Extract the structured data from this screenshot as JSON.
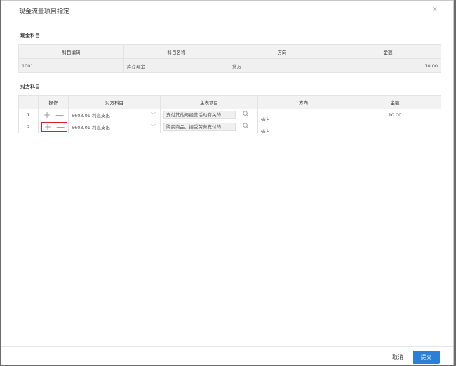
{
  "dialog": {
    "title": "现金流量项目指定",
    "close_glyph": "×"
  },
  "cash_section": {
    "title": "现金科目",
    "headers": [
      "科目编码",
      "科目名称",
      "方向",
      "金额"
    ],
    "row": {
      "code": "1001",
      "name": "库存现金",
      "direction": "贷方",
      "amount": "10.00"
    }
  },
  "counter_section": {
    "title": "对方科目",
    "headers": [
      "",
      "操作",
      "对方科目",
      "主表项目",
      "方向",
      "金额"
    ],
    "rows": [
      {
        "index": "1",
        "account": "6603.01 利息支出",
        "item": "支付其他与经营活动有关的...",
        "direction": "借方",
        "amount": "10.00"
      },
      {
        "index": "2",
        "account": "6603.01 利息支出",
        "item": "购买商品、接受劳务支付的...",
        "direction": "借方",
        "amount": ""
      }
    ],
    "add_glyph": "+",
    "remove_glyph": "—",
    "chevron_glyph": "﹀"
  },
  "footer": {
    "cancel_label": "取消",
    "submit_label": "提交"
  },
  "colors": {
    "primary": "#2a7fd6",
    "highlight_border": "#e02020"
  }
}
